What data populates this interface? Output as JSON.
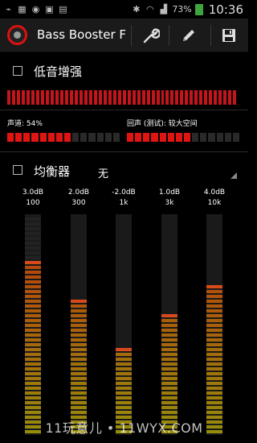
{
  "status_bar": {
    "battery": "73%",
    "time": "10:36",
    "left_icons": [
      "usb-icon",
      "image-icon",
      "chrome-icon",
      "game-icon",
      "save-icon"
    ],
    "right_icons": [
      "bluetooth-icon",
      "wifi-icon",
      "signal-icon",
      "battery-icon"
    ]
  },
  "action_bar": {
    "title": "Bass Booster F",
    "buttons": [
      "wrench-icon",
      "pencil-icon",
      "floppy-icon"
    ]
  },
  "bass_boost": {
    "label": "低音增强",
    "checked": false,
    "level": 1.0,
    "color": "#c4151c"
  },
  "channel": {
    "label": "声道: 54%",
    "level": 0.54
  },
  "echo": {
    "label": "回声 (测试): 较大空间",
    "level": 0.55
  },
  "equalizer": {
    "label": "均衡器",
    "checked": false,
    "preset": "无",
    "bands": [
      {
        "gain": "3.0dB",
        "freq": "100",
        "level": 0.8
      },
      {
        "gain": "2.0dB",
        "freq": "300",
        "level": 0.62
      },
      {
        "gain": "-2.0dB",
        "freq": "1k",
        "level": 0.4
      },
      {
        "gain": "1.0dB",
        "freq": "3k",
        "level": 0.55
      },
      {
        "gain": "4.0dB",
        "freq": "10k",
        "level": 0.7
      }
    ]
  },
  "watermark": "11玩意儿 • 11WYX.COM"
}
